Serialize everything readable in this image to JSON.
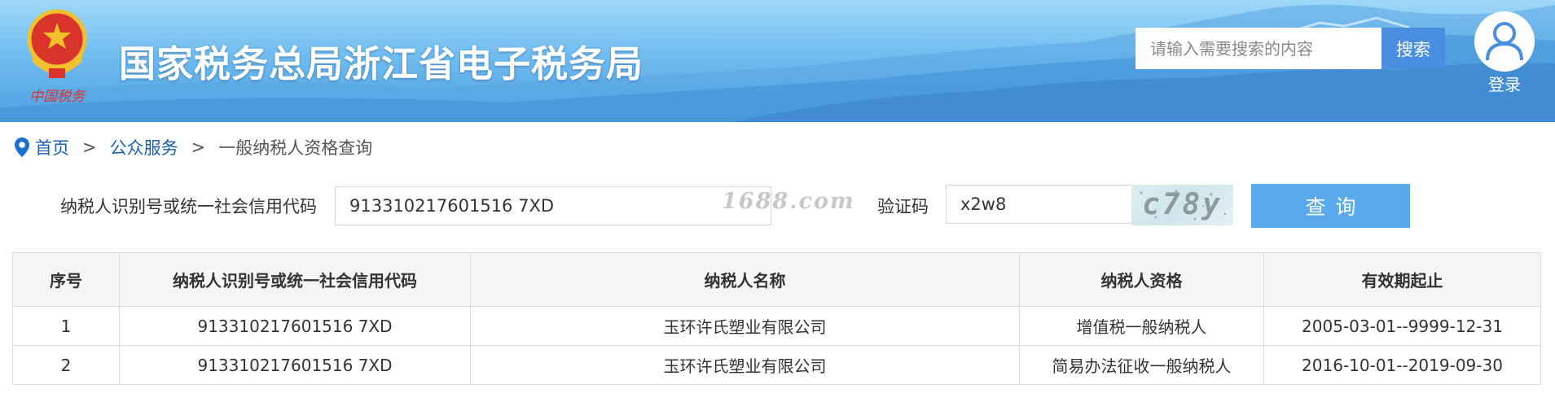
{
  "header": {
    "title": "国家税务总局浙江省电子税务局",
    "emblem_caption": "中国税务",
    "search_placeholder": "请输入需要搜索的内容",
    "search_button": "搜索",
    "login_label": "登录"
  },
  "breadcrumb": {
    "home": "首页",
    "separator": ">",
    "section": "公众服务",
    "current": "一般纳税人资格查询"
  },
  "form": {
    "code_label": "纳税人识别号或统一社会信用代码",
    "code_value": "913310217601516 7XD",
    "watermark": "1688.com",
    "captcha_label": "验证码",
    "captcha_value": "x2w8",
    "captcha_image_text": "c78y",
    "query_button": "查询"
  },
  "table": {
    "headers": [
      "序号",
      "纳税人识别号或统一社会信用代码",
      "纳税人名称",
      "纳税人资格",
      "有效期起止"
    ],
    "rows": [
      [
        "1",
        "913310217601516 7XD",
        "玉环许氏塑业有限公司",
        "增值税一般纳税人",
        "2005-03-01--9999-12-31"
      ],
      [
        "2",
        "913310217601516 7XD",
        "玉环许氏塑业有限公司",
        "简易办法征收一般纳税人",
        "2016-10-01--2019-09-30"
      ]
    ]
  },
  "colors": {
    "header_sky": "#71bdf0",
    "search_button": "#4a8ee0",
    "query_button": "#5aa9ec",
    "link": "#1a5fb4"
  }
}
